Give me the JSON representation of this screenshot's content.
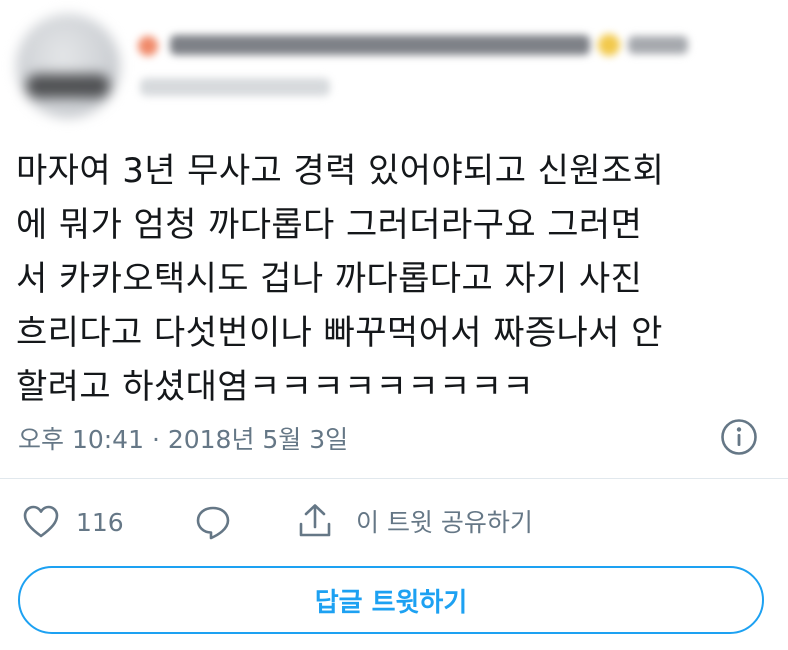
{
  "tweet": {
    "lines": [
      "마자여 3년 무사고 경력 있어야되고 신원조회",
      "에 뭐가 엄청 까다롭다 그러더라구요 그러면",
      "서 카카오택시도 겁나 까다롭다고 자기 사진",
      "흐리다고 다섯번이나 빠꾸먹어서 짜증나서 안",
      "할려고 하셨대염ㅋㅋㅋㅋㅋㅋㅋㅋㅋ"
    ],
    "timestamp": "오후 10:41 · 2018년 5월 3일"
  },
  "actions": {
    "like_count": "116",
    "share_label": "이 트윗 공유하기"
  },
  "reply_button": {
    "label": "답글 트윗하기"
  },
  "icons": {
    "info": "info-icon",
    "like": "heart-icon",
    "reply": "comment-icon",
    "share": "share-icon"
  },
  "colors": {
    "accent": "#1da1f2",
    "secondary_text": "#657786",
    "text": "#14171a",
    "divider": "#e1e8ed"
  }
}
